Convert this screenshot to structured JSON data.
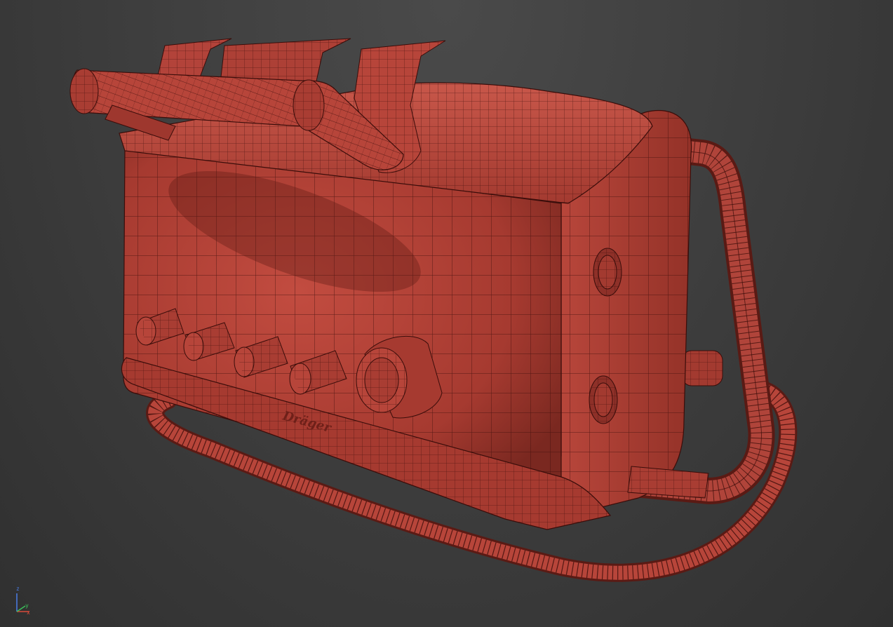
{
  "viewport": {
    "background_color": "#3d3d3d"
  },
  "model": {
    "material_color": "#b7453a",
    "wire_color": "#3a0d0a",
    "brand_label": "Dräger",
    "knob_count": 5
  },
  "gizmo": {
    "axis_z": "z",
    "axis_y": "y",
    "axis_x": "x",
    "colors": {
      "x": "#d84a3a",
      "y": "#3ac25a",
      "z": "#4a7ee8"
    }
  }
}
